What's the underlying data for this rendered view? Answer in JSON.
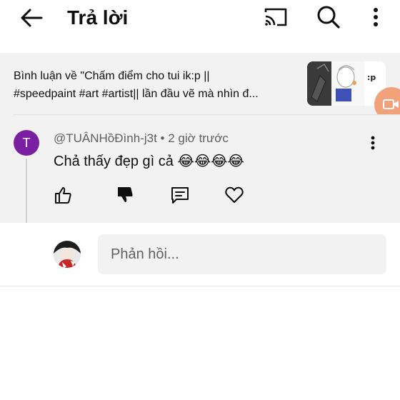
{
  "header": {
    "title": "Trả lời",
    "back_icon": "arrow-left-icon",
    "cast_icon": "cast-icon",
    "search_icon": "search-icon",
    "more_icon": "more-vertical-icon"
  },
  "video": {
    "line1": "Bình luận về \"Chấm điểm cho tui ik:p ||",
    "line2": "#speedpaint #art #artist|| lần đầu vẽ mà nhìn đ...",
    "thumbnail_text": ":p"
  },
  "comment": {
    "avatar_letter": "T",
    "avatar_color": "#7b1fa2",
    "meta": "@TUÂNHồĐình-j3t • 2 giờ trước",
    "body": "Chả thấy đẹp gì cả 😂😂😂😂",
    "actions": [
      "like-icon",
      "dislike-icon",
      "reply-icon",
      "heart-icon"
    ]
  },
  "reply": {
    "placeholder": "Phản hồi..."
  },
  "colors": {
    "panel_bg": "#f2f2f2",
    "text_primary": "#0f0f0f",
    "text_secondary": "#606060",
    "float_button": "#f2a27a"
  }
}
